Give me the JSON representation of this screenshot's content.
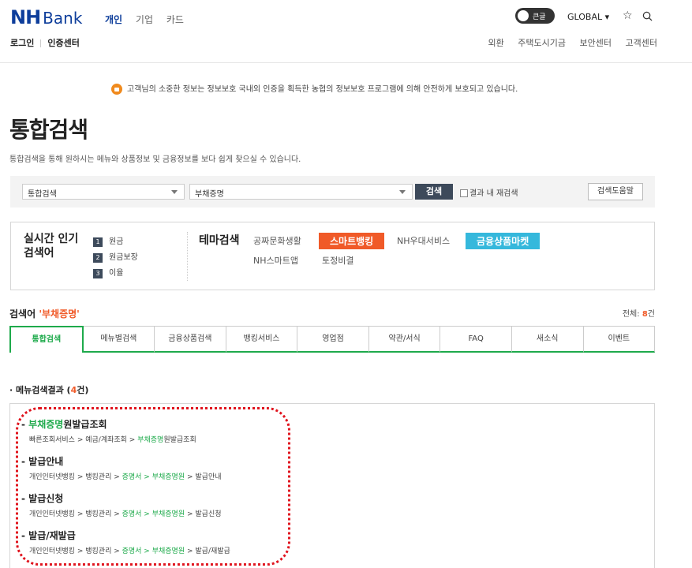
{
  "header": {
    "logo_nh": "NH",
    "logo_bank": "Bank",
    "nav": [
      "개인",
      "기업",
      "카드"
    ],
    "toggle_label": "큰글",
    "global_label": "GLOBAL ▾",
    "sub_left": [
      "로그인",
      "인증센터"
    ],
    "sub_right": [
      "외환",
      "주택도시기금",
      "보안센터",
      "고객센터"
    ]
  },
  "notice": "고객님의 소중한 정보는 정보보호 국내외 인증을 획득한 농협의 정보보호 프로그램에 의해 안전하게 보호되고 있습니다.",
  "page": {
    "title": "통합검색",
    "subtitle": "통합검색을 통해 원하시는 메뉴와 상품정보 및 금융정보를 보다 쉽게 찾으실 수 있습니다."
  },
  "search": {
    "category": "통합검색",
    "query": "부채증명",
    "button": "검색",
    "within_label": "결과 내 재검색",
    "help_button": "검색도움말"
  },
  "popular": {
    "title_line1": "실시간 인기",
    "title_line2": "검색어",
    "items": [
      {
        "rank": "1",
        "word": "원금"
      },
      {
        "rank": "2",
        "word": "원금보장"
      },
      {
        "rank": "3",
        "word": "이율"
      }
    ]
  },
  "theme": {
    "title": "테마검색",
    "items": [
      "공짜문화생활",
      "스마트뱅킹",
      "NH우대서비스",
      "금융상품마켓",
      "NH스마트앱",
      "토정비결"
    ]
  },
  "keyword": {
    "label": "검색어",
    "value": "'부채증명'",
    "total_label": "전체:",
    "total_count": "8",
    "total_unit": "건"
  },
  "tabs": [
    "통합검색",
    "메뉴별검색",
    "금융상품검색",
    "뱅킹서비스",
    "영업점",
    "약관/서식",
    "FAQ",
    "새소식",
    "이벤트"
  ],
  "results": {
    "title_prefix": "· 메뉴검색결과 (",
    "count": "4",
    "title_suffix": "건)",
    "items": [
      {
        "title_hl": "부채증명",
        "title_rest": "원발급조회",
        "path_a": "빠른조회서비스 > 예금/계좌조회 > ",
        "path_hl": "부채증명",
        "path_b": "원발급조회",
        "path_c": ""
      },
      {
        "title_hl": "",
        "title_rest": "발급안내",
        "path_a": "개인인터넷뱅킹 > 뱅킹관리 > ",
        "path_hl": "증명서 > 부채증명원",
        "path_b": " > 발급안내",
        "path_c": ""
      },
      {
        "title_hl": "",
        "title_rest": "발급신청",
        "path_a": "개인인터넷뱅킹 > 뱅킹관리 > ",
        "path_hl": "증명서 > 부채증명원",
        "path_b": " > 발급신청",
        "path_c": ""
      },
      {
        "title_hl": "",
        "title_rest": "발급/재발급",
        "path_a": "개인인터넷뱅킹 > 뱅킹관리 > ",
        "path_hl": "증명서 > 부채증명원",
        "path_b": " > 발급/재발급",
        "path_c": ""
      }
    ]
  },
  "colors": {
    "brand_blue": "#0e3e9b",
    "accent_orange": "#f05a28",
    "green": "#1eaa4b",
    "red_annotation": "#e0141e"
  }
}
